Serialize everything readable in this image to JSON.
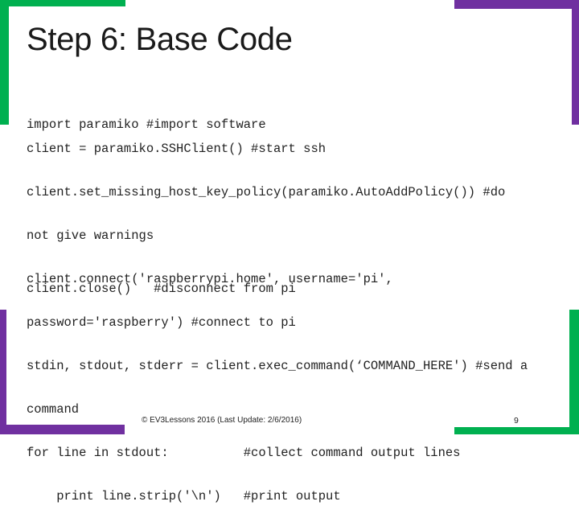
{
  "slide": {
    "title": "Step 6: Base Code",
    "colors": {
      "accent_green": "#00b050",
      "accent_purple": "#7030a0"
    },
    "code_blocks": [
      {
        "lines": [
          "import paramiko #import software"
        ]
      },
      {
        "lines": [
          "client = paramiko.SSHClient() #start ssh",
          "client.set_missing_host_key_policy(paramiko.AutoAddPolicy()) #do",
          "not give warnings",
          "client.connect('raspberrypi.home', username='pi',",
          "password='raspberry') #connect to pi",
          "stdin, stdout, stderr = client.exec_command(‘COMMAND_HERE') #send a",
          "command",
          "for line in stdout:          #collect command output lines",
          "    print line.strip('\\n')   #print output"
        ]
      },
      {
        "lines": [
          "client.close()   #disconnect from pi"
        ]
      }
    ],
    "footer": "© EV3Lessons 2016 (Last Update: 2/6/2016)",
    "page_number": "9"
  }
}
